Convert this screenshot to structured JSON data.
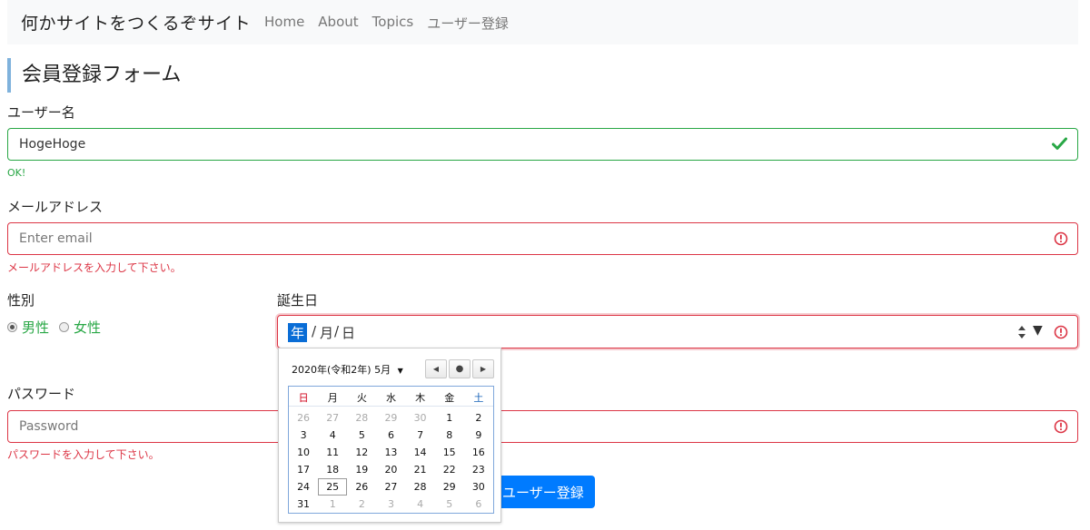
{
  "navbar": {
    "brand": "何かサイトをつくるぞサイト",
    "links": [
      "Home",
      "About",
      "Topics",
      "ユーザー登録"
    ]
  },
  "form": {
    "title": "会員登録フォーム",
    "username": {
      "label": "ユーザー名",
      "value": "HogeHoge",
      "feedback": "OK!"
    },
    "email": {
      "label": "メールアドレス",
      "placeholder": "Enter email",
      "feedback": "メールアドレスを入力して下さい。"
    },
    "gender": {
      "label": "性別",
      "options": [
        "男性",
        "女性"
      ],
      "selected": "男性"
    },
    "birthday": {
      "label": "誕生日",
      "segments": [
        "年",
        "月",
        "日"
      ],
      "separator": "/"
    },
    "password": {
      "label": "パスワード",
      "placeholder": "Password",
      "feedback": "パスワードを入力して下さい。"
    },
    "submit_label": "ユーザー登録"
  },
  "calendar": {
    "month_label": "2020年(令和2年) 5月",
    "weekdays": [
      "日",
      "月",
      "火",
      "水",
      "木",
      "金",
      "土"
    ],
    "today": "25",
    "weeks": [
      [
        "26",
        "27",
        "28",
        "29",
        "30",
        "1",
        "2"
      ],
      [
        "3",
        "4",
        "5",
        "6",
        "7",
        "8",
        "9"
      ],
      [
        "10",
        "11",
        "12",
        "13",
        "14",
        "15",
        "16"
      ],
      [
        "17",
        "18",
        "19",
        "20",
        "21",
        "22",
        "23"
      ],
      [
        "24",
        "25",
        "26",
        "27",
        "28",
        "29",
        "30"
      ],
      [
        "31",
        "1",
        "2",
        "3",
        "4",
        "5",
        "6"
      ]
    ],
    "dimmed": [
      [
        0,
        0
      ],
      [
        0,
        1
      ],
      [
        0,
        2
      ],
      [
        0,
        3
      ],
      [
        0,
        4
      ],
      [
        5,
        1
      ],
      [
        5,
        2
      ],
      [
        5,
        3
      ],
      [
        5,
        4
      ],
      [
        5,
        5
      ],
      [
        5,
        6
      ]
    ]
  },
  "colors": {
    "valid": "#28a745",
    "invalid": "#dc3545",
    "primary": "#007bff"
  },
  "icons": {
    "valid": "check-icon",
    "invalid": "exclamation-circle-icon"
  }
}
